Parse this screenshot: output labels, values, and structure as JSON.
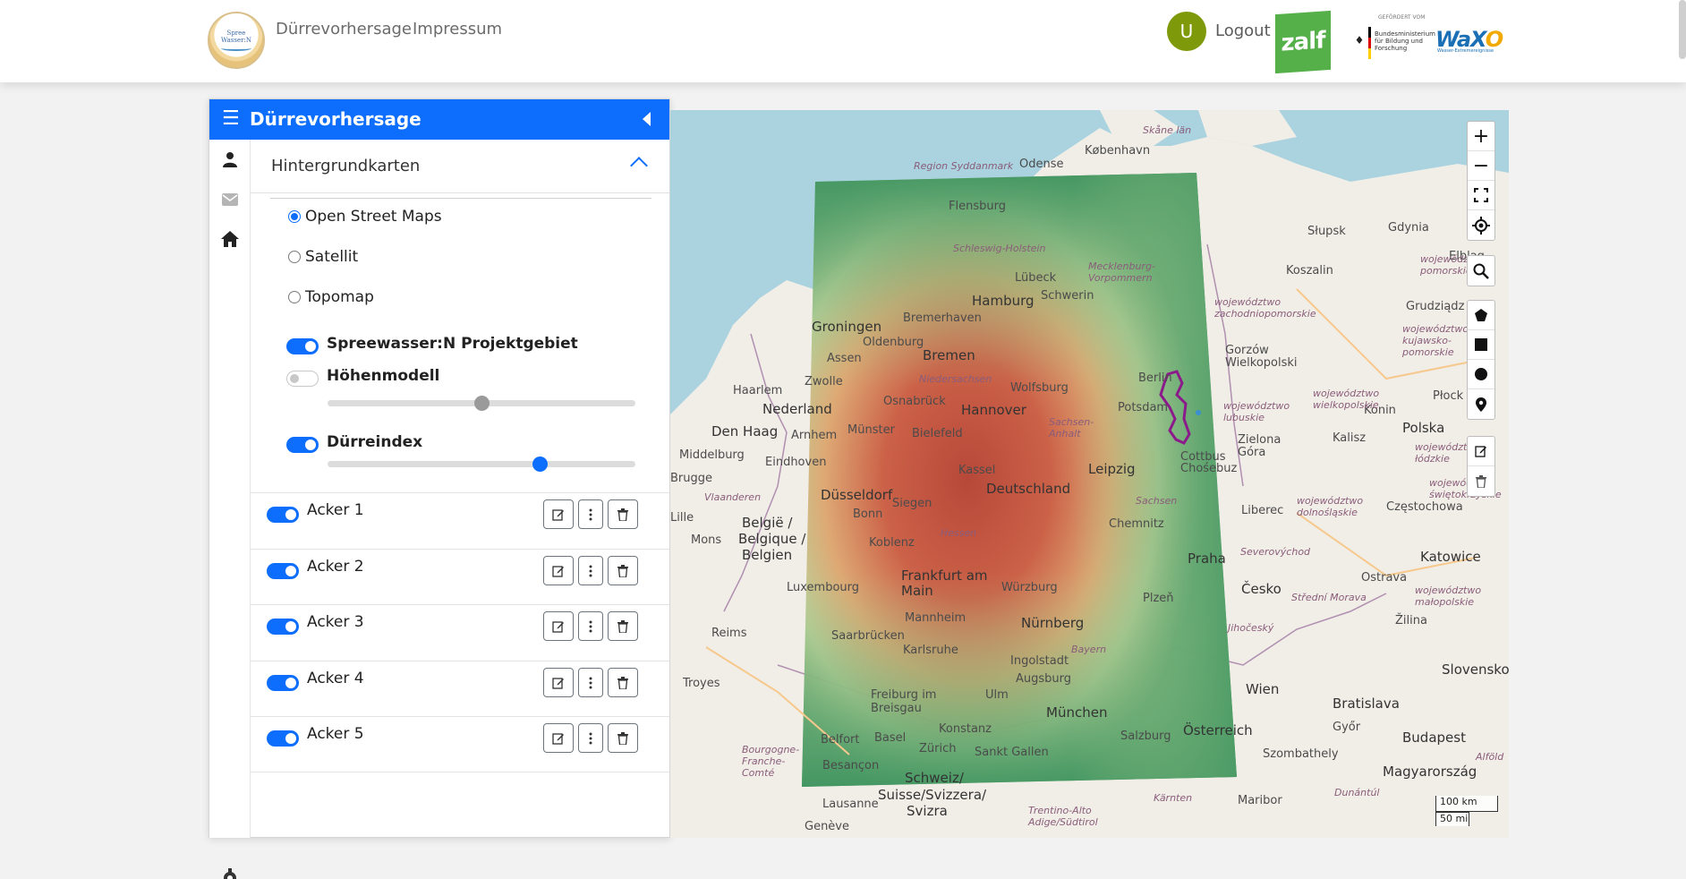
{
  "nav": {
    "logo_line1": "Spree",
    "logo_line2": "Wasser:N",
    "links": [
      "Dürrevorhersage",
      "Impressum"
    ],
    "avatar_initial": "U",
    "logout_label": "Logout",
    "zalf_logo_text": "zalf",
    "bmbf_caption": "GEFÖRDERT VOM",
    "bmbf_text": "Bundesministerium für Bildung und Forschung",
    "waxo_text": "WaX",
    "waxo_o": "O",
    "waxo_sub": "Wasser-Extremereignisse"
  },
  "panel": {
    "title": "Dürrevorhersage",
    "rail_icons": [
      "user-icon",
      "envelope-icon",
      "home-icon",
      "gear-icon"
    ],
    "accordion_title": "Hintergrundkarten",
    "basemaps": [
      {
        "label": "Open Street Maps",
        "checked": true
      },
      {
        "label": "Satellit",
        "checked": false
      },
      {
        "label": "Topomap",
        "checked": false
      }
    ],
    "layers": [
      {
        "label": "Spreewasser:N Projektgebiet",
        "enabled": true
      },
      {
        "label": "Höhenmodell",
        "enabled": false,
        "opacity": 0.5
      },
      {
        "label": "Dürreindex",
        "enabled": true,
        "opacity": 0.69
      }
    ],
    "fields": [
      {
        "label": "Acker 1",
        "enabled": true
      },
      {
        "label": "Acker 2",
        "enabled": true
      },
      {
        "label": "Acker 3",
        "enabled": true
      },
      {
        "label": "Acker 4",
        "enabled": true
      },
      {
        "label": "Acker 5",
        "enabled": true
      }
    ]
  },
  "map": {
    "controls": {
      "zoom_in": "+",
      "zoom_out": "−"
    },
    "scale_km": "100 km",
    "scale_mi": "50 mi",
    "labels": {
      "copenhagen": "København",
      "odense": "Odense",
      "skane": "Skåne län",
      "syddanmark": "Region Syddanmark",
      "flensburg": "Flensburg",
      "schleswig": "Schleswig-Holstein",
      "mecklenburg": "Mecklenburg-Vorpommern",
      "lubeck": "Lübeck",
      "schwerin": "Schwerin",
      "hamburg": "Hamburg",
      "bremerhaven": "Bremerhaven",
      "groningen": "Groningen",
      "oldenburg": "Oldenburg",
      "bremen": "Bremen",
      "assen": "Assen",
      "zwolle": "Zwolle",
      "haarlem": "Haarlem",
      "nederland": "Nederland",
      "den_haag": "Den Haag",
      "arnhem": "Arnhem",
      "middelburg": "Middelburg",
      "eindhoven": "Eindhoven",
      "brugge": "Brugge",
      "vlaanderen": "Vlaanderen",
      "lille": "Lille",
      "mons": "Mons",
      "belgie": "België /",
      "belgique": "Belgique /",
      "belgien": "Belgien",
      "osnabruck": "Osnabrück",
      "niedersachsen": "Niedersachsen",
      "wolfsburg": "Wolfsburg",
      "hannover": "Hannover",
      "munster": "Münster",
      "bielefeld": "Bielefeld",
      "sachsen_anhalt": "Sachsen-Anhalt",
      "potsdam": "Potsdam",
      "berlin": "Berlin",
      "kassel": "Kassel",
      "leipzig": "Leipzig",
      "deutschland": "Deutschland",
      "cottbus": "Cottbus",
      "chosebuz": "Chośebuz",
      "dusseldorf": "Düsseldorf",
      "bonn": "Bonn",
      "siegen": "Siegen",
      "koblenz": "Koblenz",
      "hessen": "Hessen",
      "chemnitz": "Chemnitz",
      "sachsen": "Sachsen",
      "frankfurt": "Frankfurt am Main",
      "wurzburg": "Würzburg",
      "plzen": "Plzeň",
      "praha": "Praha",
      "liberec": "Liberec",
      "luxembourg": "Luxembourg",
      "saarbrucken": "Saarbrücken",
      "mannheim": "Mannheim",
      "nurnberg": "Nürnberg",
      "reims": "Reims",
      "troyes": "Troyes",
      "karlsruhe": "Karlsruhe",
      "ingolstadt": "Ingolstadt",
      "bayern": "Bayern",
      "augsburg": "Augsburg",
      "ulm": "Ulm",
      "freiburg": "Freiburg im Breisgau",
      "munchen": "München",
      "salzburg": "Salzburg",
      "osterreich": "Österreich",
      "belfort": "Belfort",
      "basel": "Basel",
      "zurich": "Zürich",
      "konstanz": "Konstanz",
      "sankt_gallen": "Sankt Gallen",
      "besancon": "Besançon",
      "bourgogne": "Bourgogne-Franche-Comté",
      "schweiz": "Schweiz/",
      "suisse": "Suisse/Svizzera/",
      "svizra": "Svizra",
      "lausanne": "Lausanne",
      "geneve": "Genève",
      "trentino": "Trentino-Alto Adige/Südtirol",
      "karnten": "Kärnten",
      "wien": "Wien",
      "bratislava": "Bratislava",
      "gyor": "Győr",
      "szombathely": "Szombathely",
      "maribor": "Maribor",
      "budapest": "Budapest",
      "magyarorszag": "Magyarország",
      "slovensko": "Slovensko",
      "zilina": "Žilina",
      "ostrava": "Ostrava",
      "katowice": "Katowice",
      "cesko": "Česko",
      "jihocesky": "Jihočeský",
      "stredni_morava": "Střední Morava",
      "severovychod": "Severovýchod",
      "czestochowa": "Częstochowa",
      "polska": "Polska",
      "kalisz": "Kalisz",
      "konin": "Konin",
      "plock": "Płock",
      "lodzkie": "województwo łódzkie",
      "wielkopolskie": "województwo wielkopolskie",
      "zielona_gora": "Zielona Góra",
      "lubuskie": "województwo lubuskie",
      "gorzow": "Gorzów Wielkopolski",
      "zachodniopomorskie": "województwo zachodniopomorskie",
      "koszalin": "Koszalin",
      "slupsk": "Słupsk",
      "gdynia": "Gdynia",
      "elblag": "Elbląg",
      "pomorskie": "województwo pomorskie",
      "grudziadz": "Grudziądz",
      "kujawsko": "województwo kujawsko-pomorskie",
      "dolnoslaskie": "województwo dolnośląskie",
      "malopolskie": "województwo małopolskie",
      "swietokrzyskie": "województwo świętokrzyskie",
      "alfold": "Alföld",
      "dunantul": "Dunántúl"
    }
  }
}
